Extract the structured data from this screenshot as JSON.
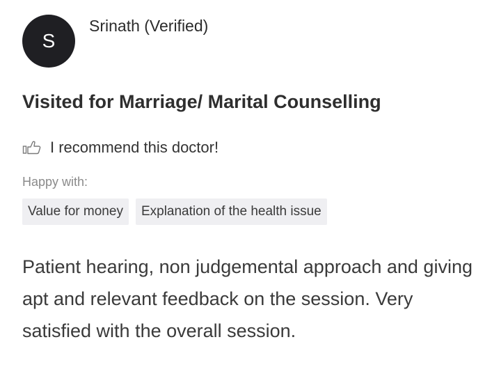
{
  "reviewer": {
    "initial": "S",
    "name": "Srinath (Verified)"
  },
  "visit_reason": "Visited for Marriage/ Marital Counselling",
  "recommendation": {
    "icon": "thumbs-up-icon",
    "text": "I recommend this doctor!"
  },
  "happy_with": {
    "label": "Happy with:",
    "tags": [
      "Value for money",
      "Explanation of the health issue"
    ]
  },
  "review_text": "Patient hearing, non judgemental approach and giving apt and relevant feedback on the session. Very satisfied with the overall session.",
  "colors": {
    "avatar_bg": "#1f1f23",
    "tag_bg": "#efeff2",
    "muted_text": "#8a8a8a"
  }
}
